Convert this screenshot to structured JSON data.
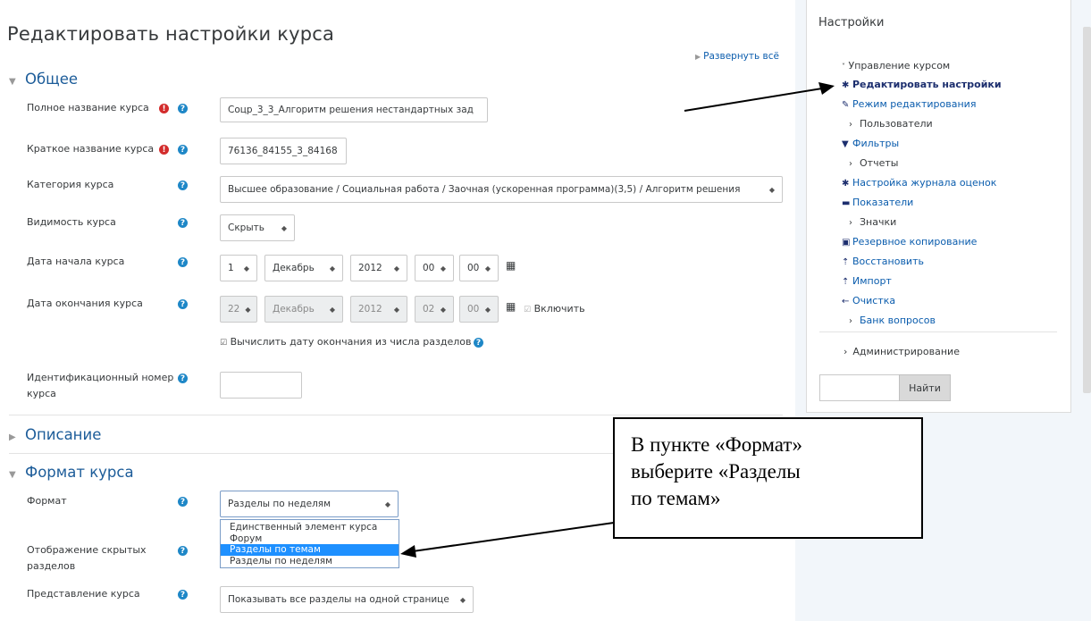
{
  "page_title": "Редактировать настройки курса",
  "expand_all": "Развернуть всё",
  "sections": {
    "general": "Общее",
    "description": "Описание",
    "format": "Формат курса"
  },
  "fields": {
    "fullname_label": "Полное название курса",
    "fullname_value": "Соцр_3_3_Алгоритм решения нестандартных зад",
    "shortname_label": "Краткое название курса",
    "shortname_value": "76136_84155_3_84168",
    "category_label": "Категория курса",
    "category_value": "Высшее образование / Социальная работа / Заочная (ускоренная программа)(3,5) / Алгоритм решения",
    "visibility_label": "Видимость курса",
    "visibility_value": "Скрыть",
    "startdate_label": "Дата начала курса",
    "start_day": "1",
    "start_month": "Декабрь",
    "start_year": "2012",
    "start_hour": "00",
    "start_min": "00",
    "enddate_label": "Дата окончания курса",
    "end_day": "22",
    "end_month": "Декабрь",
    "end_year": "2012",
    "end_hour": "02",
    "end_min": "00",
    "enable_label": "Включить",
    "calc_enddate_label": "Вычислить дату окончания из числа разделов",
    "idnumber_label_1": "Идентификационный номер",
    "idnumber_label_2": "курса",
    "format_label": "Формат",
    "format_value": "Разделы по неделям",
    "format_options": [
      "Единственный элемент курса",
      "Форум",
      "Разделы по темам",
      "Разделы по неделям"
    ],
    "format_highlighted_index": 2,
    "hidden_label_1": "Отображение скрытых",
    "hidden_label_2": "разделов",
    "layout_label": "Представление курса",
    "layout_value": "Показывать все разделы на одной странице"
  },
  "sidebar": {
    "title": "Настройки",
    "manage_course": "Управление курсом",
    "items": [
      {
        "label": "Редактировать настройки",
        "icon": "gear-icon"
      },
      {
        "label": "Режим редактирования",
        "icon": "pencil-icon"
      },
      {
        "label": "Пользователи",
        "icon": "chevron-right-icon"
      },
      {
        "label": "Фильтры",
        "icon": "filter-icon"
      },
      {
        "label": "Отчеты",
        "icon": "chevron-right-icon"
      },
      {
        "label": "Настройка журнала оценок",
        "icon": "gear-icon"
      },
      {
        "label": "Показатели",
        "icon": "badge-icon"
      },
      {
        "label": "Значки",
        "icon": "chevron-right-icon"
      },
      {
        "label": "Резервное копирование",
        "icon": "backup-icon"
      },
      {
        "label": "Восстановить",
        "icon": "upload-icon"
      },
      {
        "label": "Импорт",
        "icon": "upload-icon"
      },
      {
        "label": "Очистка",
        "icon": "arrow-left-icon"
      },
      {
        "label": "Банк вопросов",
        "icon": "chevron-right-icon"
      }
    ],
    "administration": "Администрирование",
    "search_button": "Найти"
  },
  "callout": {
    "line1": "В пункте «Формат»",
    "line2": "выберите «Разделы",
    "line3": "по темам»"
  },
  "colors": {
    "link": "#0a5cad",
    "section_heading": "#1c5c99",
    "required_icon": "#d32c2c",
    "help_icon": "#1e87c7",
    "highlight": "#1e90ff"
  }
}
